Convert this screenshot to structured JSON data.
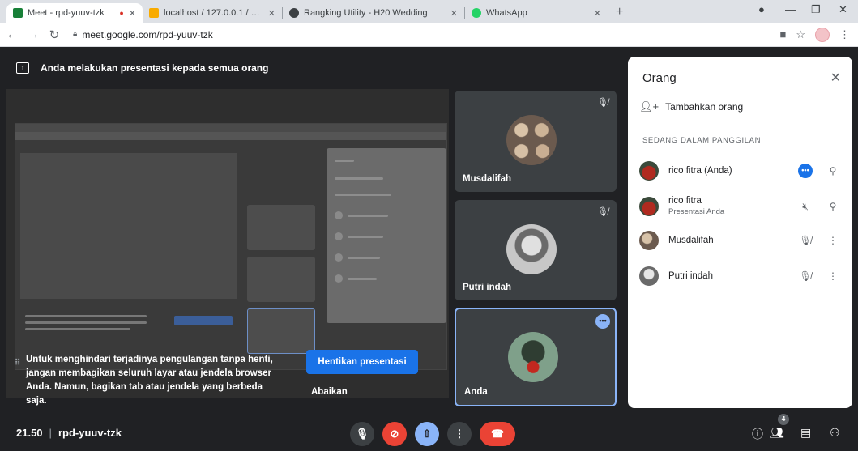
{
  "browser": {
    "tabs": [
      {
        "title": "Meet - rpd-yuuv-tzk",
        "fav_color": "#188038",
        "recording": true
      },
      {
        "title": "localhost / 127.0.0.1 / planner | p",
        "fav_color": "#f9ab00"
      },
      {
        "title": "Rangking Utility - H20 Wedding",
        "fav_color": "#3c4043"
      },
      {
        "title": "WhatsApp",
        "fav_color": "#25d366"
      }
    ],
    "new_tab": "+",
    "url": "meet.google.com/rpd-yuuv-tzk"
  },
  "meet": {
    "banner": "Anda melakukan presentasi kepada semua orang",
    "warning": "Untuk menghindari terjadinya pengulangan tanpa henti, jangan membagikan seluruh layar atau jendela browser Anda. Namun, bagikan tab atau jendela yang berbeda saja.",
    "stop_button": "Hentikan presentasi",
    "ignore": "Abaikan",
    "tiles": [
      {
        "name": "Musdalifah"
      },
      {
        "name": "Putri indah"
      },
      {
        "name": "Anda"
      }
    ]
  },
  "panel": {
    "title": "Orang",
    "add_people": "Tambahkan orang",
    "section": "SEDANG DALAM PANGGILAN",
    "people": [
      {
        "name": "rico fitra (Anda)",
        "sub": ""
      },
      {
        "name": "rico fitra",
        "sub": "Presentasi Anda"
      },
      {
        "name": "Musdalifah",
        "sub": ""
      },
      {
        "name": "Putri indah",
        "sub": ""
      }
    ]
  },
  "bottom": {
    "time": "21.50",
    "code": "rpd-yuuv-tzk",
    "people_count": "4"
  },
  "colors": {
    "accent": "#1a73e8",
    "end_call": "#ea4335",
    "present_active": "#8ab4f8"
  }
}
